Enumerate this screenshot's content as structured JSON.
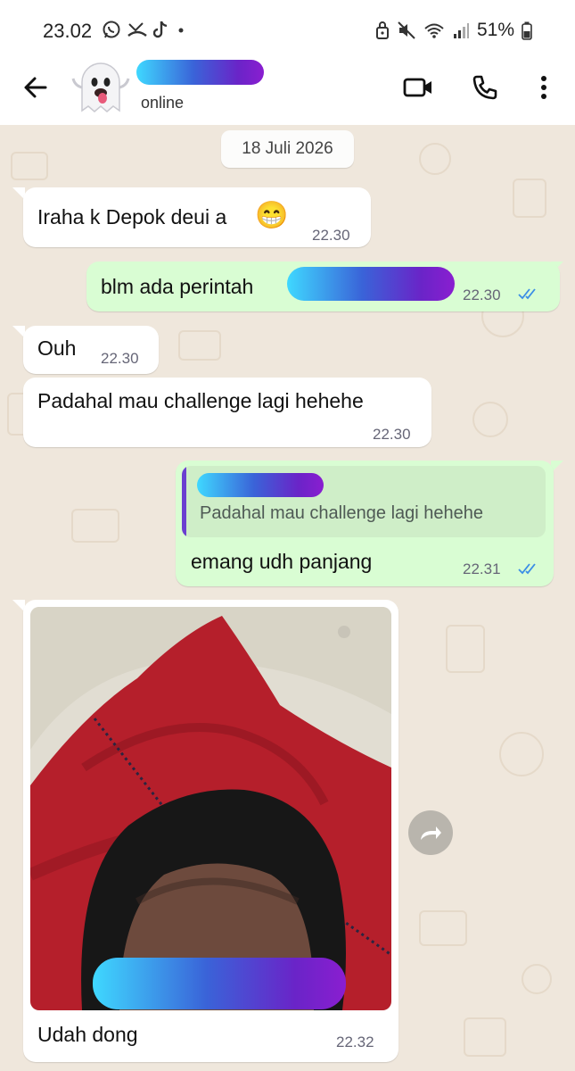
{
  "status_bar": {
    "time": "23.02",
    "battery": "51%",
    "icons_left": [
      "whatsapp-icon",
      "missed-call-icon",
      "tiktok-icon",
      "dot-icon"
    ],
    "icons_right": [
      "lock-icon",
      "mute-icon",
      "wifi-icon",
      "signal-icon",
      "battery-icon"
    ]
  },
  "header": {
    "contact_status": "online",
    "actions": [
      "video-call-icon",
      "voice-call-icon",
      "more-icon"
    ]
  },
  "chat": {
    "date_chip": "18 Juli 2026",
    "messages": [
      {
        "direction": "in",
        "text": "Iraha k Depok deui a",
        "emoji": "😁",
        "time": "22.30"
      },
      {
        "direction": "out",
        "text": "blm ada perintah",
        "time": "22.30",
        "read": true
      },
      {
        "direction": "in",
        "text": "Ouh",
        "time": "22.30"
      },
      {
        "direction": "in",
        "text": "Padahal mau challenge lagi hehehe",
        "time": "22.30"
      },
      {
        "direction": "out",
        "quoted_text": "Padahal mau challenge lagi hehehe",
        "text": "emang udh panjang",
        "time": "22.31",
        "read": true
      },
      {
        "direction": "in",
        "type": "image",
        "caption": "Udah dong",
        "time": "22.32"
      }
    ]
  },
  "colors": {
    "chat_bg": "#efe7dc",
    "outgoing_bubble": "#d9fdd3",
    "incoming_bubble": "#ffffff",
    "read_ticks": "#3b8ee6",
    "redaction_gradient": [
      "#3fd8ff",
      "#3a63d8",
      "#6a24c8",
      "#8a1ed0"
    ]
  }
}
